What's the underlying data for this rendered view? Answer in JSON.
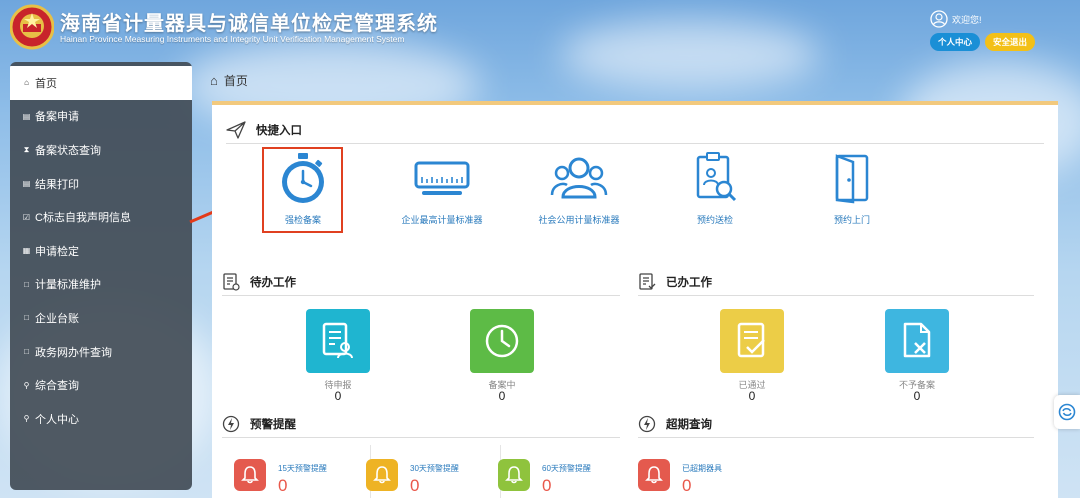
{
  "header": {
    "title_cn": "海南省计量器具与诚信单位检定管理系统",
    "title_en": "Hainan Province Measuring Instruments and Integrity Unit Verification Management System",
    "welcome": "欢迎您!",
    "personal_center_btn": "个人中心",
    "logout_btn": "安全退出"
  },
  "sidebar": {
    "items": [
      {
        "label": "首页",
        "icon": "home-icon"
      },
      {
        "label": "备案申请",
        "icon": "stack-icon"
      },
      {
        "label": "备案状态查询",
        "icon": "hourglass-icon"
      },
      {
        "label": "结果打印",
        "icon": "stack-icon"
      },
      {
        "label": "C标志自我声明信息",
        "icon": "check-square-icon"
      },
      {
        "label": "申请检定",
        "icon": "card-icon"
      },
      {
        "label": "计量标准维护",
        "icon": "file-icon"
      },
      {
        "label": "企业台账",
        "icon": "file-icon"
      },
      {
        "label": "政务网办件查询",
        "icon": "file-icon"
      },
      {
        "label": "综合查询",
        "icon": "search-icon"
      },
      {
        "label": "个人中心",
        "icon": "user-icon"
      }
    ]
  },
  "breadcrumb": {
    "label": "首页"
  },
  "quick_entry": {
    "title": "快捷入口",
    "items": [
      {
        "label": "强检备案",
        "icon": "stopwatch-icon"
      },
      {
        "label": "企业最高计量标准器",
        "icon": "ruler-icon"
      },
      {
        "label": "社会公用计量标准器",
        "icon": "users-icon"
      },
      {
        "label": "预约送检",
        "icon": "clipboard-search-icon"
      },
      {
        "label": "预约上门",
        "icon": "door-icon"
      }
    ]
  },
  "todo": {
    "title": "待办工作",
    "tiles": [
      {
        "label": "待申报",
        "count": "0",
        "color": "#1fb5d0"
      },
      {
        "label": "备案中",
        "count": "0",
        "color": "#5dbb46"
      }
    ]
  },
  "done": {
    "title": "已办工作",
    "tiles": [
      {
        "label": "已通过",
        "count": "0",
        "color": "#eccd47"
      },
      {
        "label": "不予备案",
        "count": "0",
        "color": "#3eb6e0"
      }
    ]
  },
  "warning": {
    "title": "预警提醒",
    "items": [
      {
        "label": "15天预警提醒",
        "count": "0",
        "color": "#e45a4e"
      },
      {
        "label": "30天预警提醒",
        "count": "0",
        "color": "#eeb324"
      },
      {
        "label": "60天预警提醒",
        "count": "0",
        "color": "#8fc33d"
      }
    ]
  },
  "overdue": {
    "title": "超期查询",
    "items": [
      {
        "label": "已超期器具",
        "count": "0",
        "color": "#e45a4e"
      }
    ]
  }
}
